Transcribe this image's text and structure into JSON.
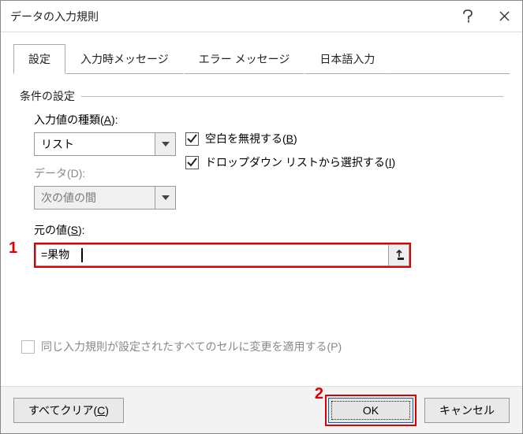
{
  "title": "データの入力規則",
  "tabs": {
    "settings": "設定",
    "input_msg": "入力時メッセージ",
    "error_msg": "エラー メッセージ",
    "ime": "日本語入力"
  },
  "fieldset": "条件の設定",
  "allow_label_pre": "入力値の種類(",
  "allow_key": "A",
  "allow_label_post": "):",
  "allow_value": "リスト",
  "data_label": "データ(D):",
  "data_value": "次の値の間",
  "ignore_blank_pre": "空白を無視する(",
  "ignore_blank_key": "B",
  "ignore_blank_post": ")",
  "dropdown_pre": "ドロップダウン リストから選択する(",
  "dropdown_key": "I",
  "dropdown_post": ")",
  "source_label_pre": "元の値(",
  "source_key": "S",
  "source_label_post": "):",
  "source_value": "=果物",
  "apply_label": "同じ入力規則が設定されたすべてのセルに変更を適用する(P)",
  "clear_pre": "すべてクリア(",
  "clear_key": "C",
  "clear_post": ")",
  "ok": "OK",
  "cancel": "キャンセル",
  "annot1": "1",
  "annot2": "2"
}
